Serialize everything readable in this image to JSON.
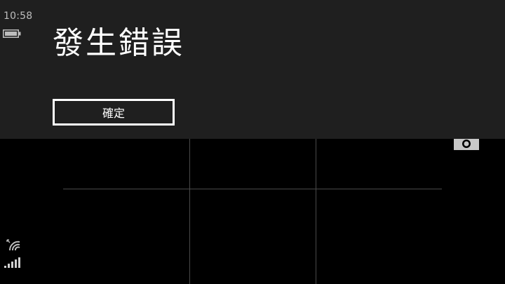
{
  "status_bar": {
    "time": "10:58",
    "icons": [
      "battery-icon",
      "wifi-icon",
      "signal-strength-icon"
    ]
  },
  "dialog": {
    "title": "發生錯誤",
    "confirm_label": "確定"
  },
  "camera": {
    "icons": [
      "camera-icon"
    ]
  }
}
